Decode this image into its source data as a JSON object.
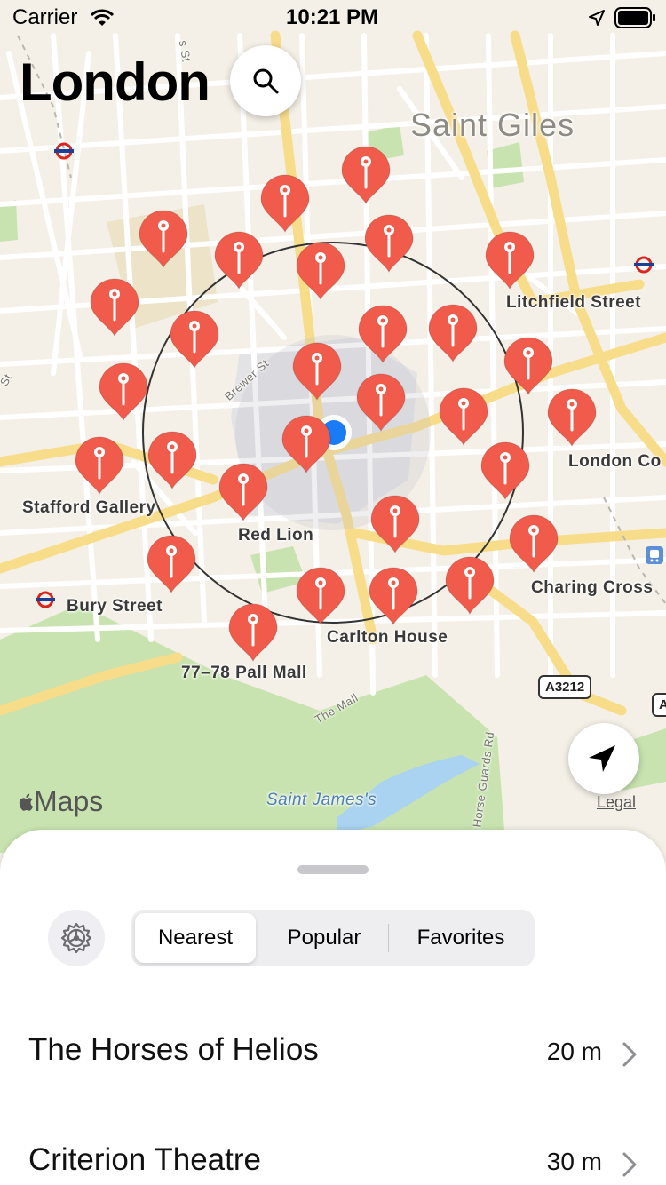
{
  "status_bar": {
    "carrier": "Carrier",
    "time": "10:21 PM"
  },
  "header": {
    "title": "London"
  },
  "map": {
    "place_labels": [
      "Saint Giles",
      "Litchfield Street",
      "London Co",
      "Stafford Gallery",
      "Red Lion",
      "Bury Street",
      "Charing Cross",
      "Carlton House",
      "77–78 Pall Mall"
    ],
    "street_labels": [
      "Brewer St",
      "The Mall",
      "Horse Guards Rd",
      "s St",
      "St"
    ],
    "park_label": "Saint James's",
    "road_shields": [
      "A3212",
      "A"
    ],
    "attribution": "Maps",
    "legal": "Legal"
  },
  "sheet": {
    "segments": [
      "Nearest",
      "Popular",
      "Favorites"
    ],
    "selected_segment": "Nearest",
    "places": [
      {
        "name": "The Horses of Helios",
        "distance": "20 m"
      },
      {
        "name": "Criterion Theatre",
        "distance": "30 m"
      }
    ]
  },
  "colors": {
    "pin": "#f15b4b",
    "user_location": "#1a7cf5",
    "park": "#c8e3b0",
    "water": "#a9d3f0"
  },
  "icons": [
    "wifi-icon",
    "location-arrow-icon",
    "battery-icon",
    "search-icon",
    "locate-icon",
    "gear-icon",
    "chevron-right-icon",
    "tube-icon",
    "train-icon",
    "apple-icon"
  ]
}
